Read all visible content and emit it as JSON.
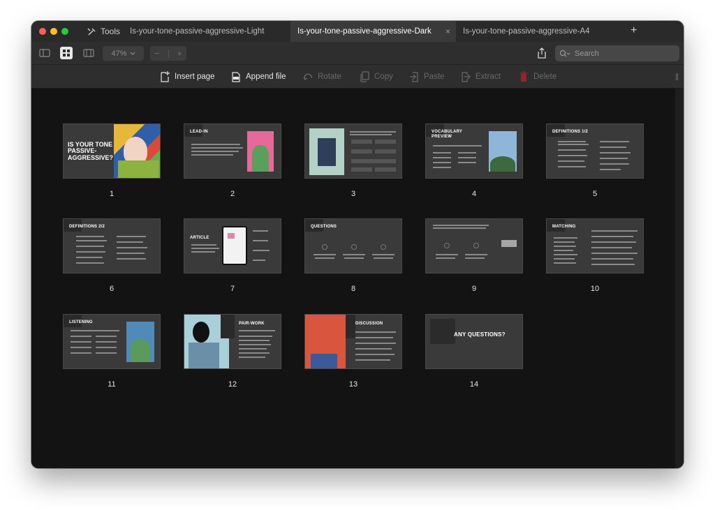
{
  "window": {
    "tools_label": "Tools",
    "tabs": [
      {
        "title": "Is-your-tone-passive-aggressive-Light",
        "active": false
      },
      {
        "title": "Is-your-tone-passive-aggressive-Dark",
        "active": true
      },
      {
        "title": "Is-your-tone-passive-aggressive-A4",
        "active": false
      }
    ],
    "tab_close_glyph": "×",
    "new_tab_glyph": "+"
  },
  "toolbar": {
    "zoom": "47%",
    "zoom_minus": "−",
    "zoom_plus": "+",
    "search_placeholder": "Search"
  },
  "actions": {
    "insert_page": "Insert page",
    "append_file": "Append file",
    "rotate": "Rotate",
    "copy": "Copy",
    "paste": "Paste",
    "extract": "Extract",
    "delete": "Delete"
  },
  "pages": [
    {
      "number": "1",
      "title": "IS YOUR TONE PASSIVE-AGGRESSIVE?"
    },
    {
      "number": "2",
      "title": "LEAD-IN"
    },
    {
      "number": "3",
      "title": ""
    },
    {
      "number": "4",
      "title": "VOCABULARY PREVIEW"
    },
    {
      "number": "5",
      "title": "DEFINITIONS 1/2"
    },
    {
      "number": "6",
      "title": "DEFINITIONS 2/2"
    },
    {
      "number": "7",
      "title": "ARTICLE"
    },
    {
      "number": "8",
      "title": "QUESTIONS"
    },
    {
      "number": "9",
      "title": ""
    },
    {
      "number": "10",
      "title": "MATCHING"
    },
    {
      "number": "11",
      "title": "LISTENING"
    },
    {
      "number": "12",
      "title": "PAIR-WORK"
    },
    {
      "number": "13",
      "title": "DISCUSSION"
    },
    {
      "number": "14",
      "title": "ANY QUESTIONS?"
    }
  ],
  "colors": {
    "window_bg": "#1d1d1d",
    "content_bg": "#131313",
    "slide_bg": "#3a3a3a",
    "active_tab": "#3a3a3a",
    "delete_icon": "#8a2a2a"
  }
}
